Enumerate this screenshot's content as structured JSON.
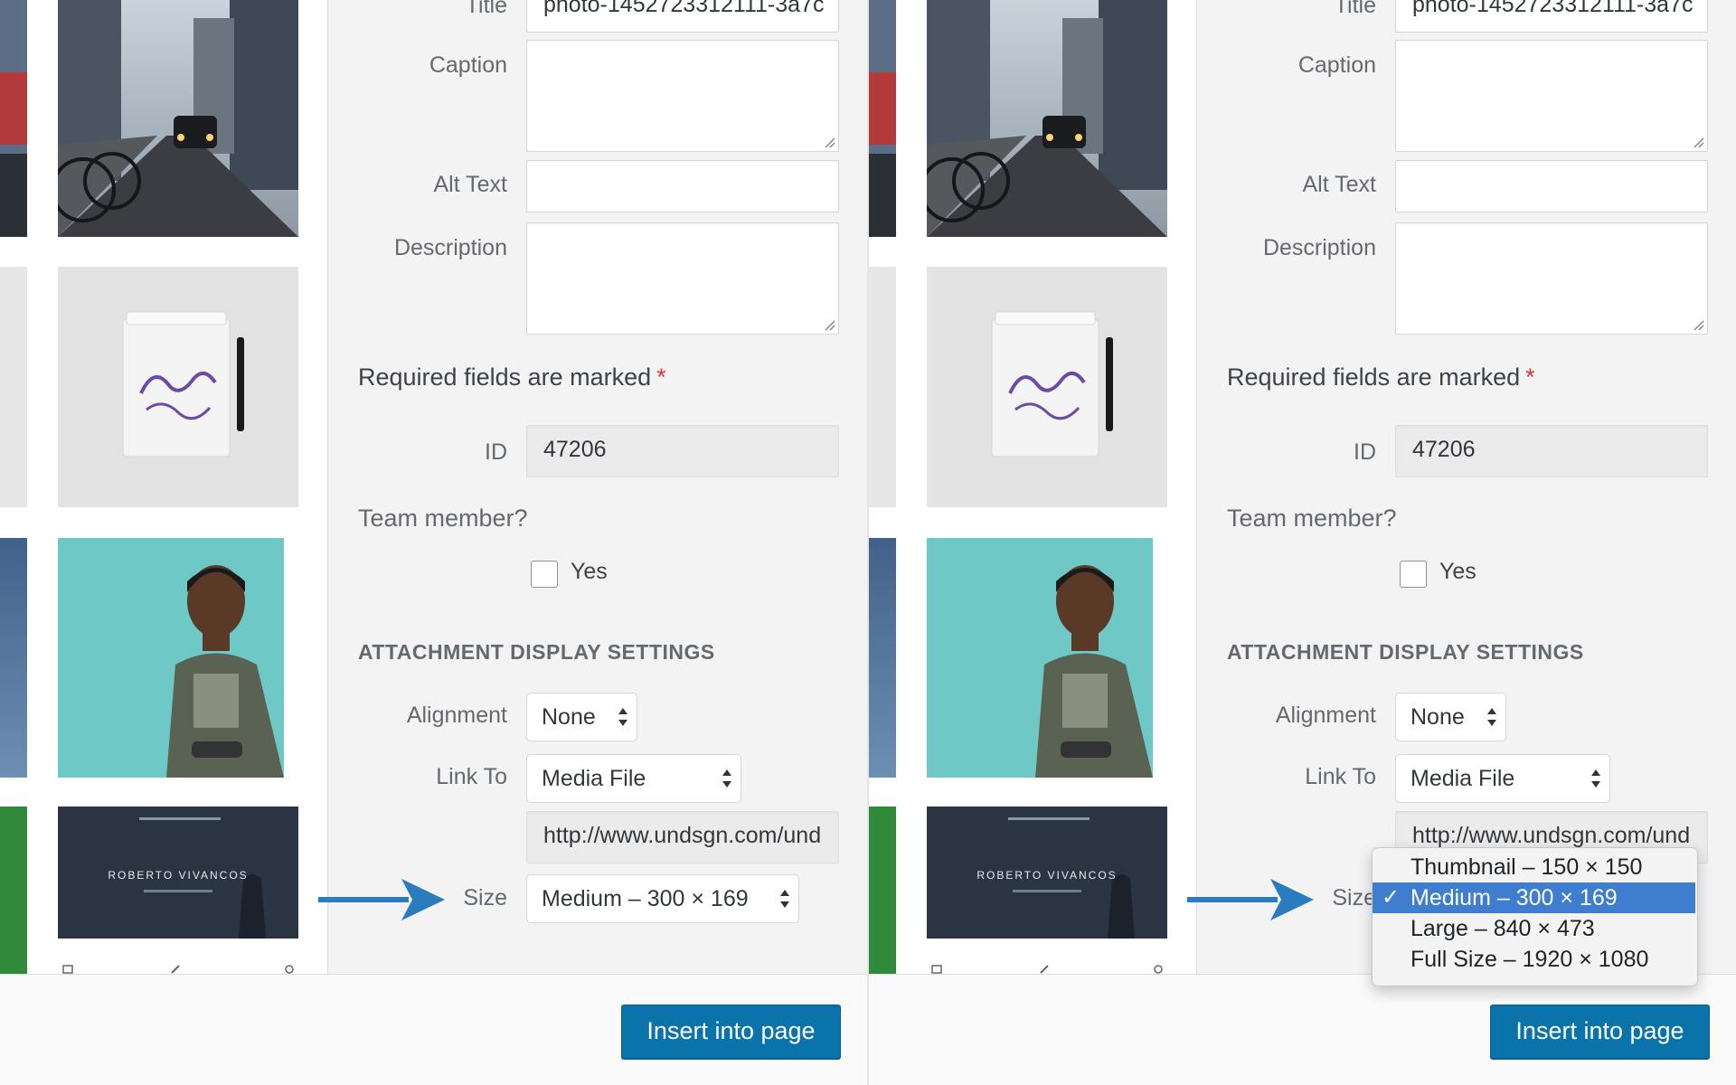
{
  "sidebar": {
    "title_label": "Title",
    "title_value": "photo-1452723312111-3a7c",
    "caption_label": "Caption",
    "alt_label": "Alt Text",
    "description_label": "Description",
    "required_text": "Required fields are marked",
    "required_star": "*",
    "id_label": "ID",
    "id_value": "47206",
    "team_label": "Team member?",
    "team_checkbox_label": "Yes",
    "section_heading": "ATTACHMENT DISPLAY SETTINGS",
    "alignment_label": "Alignment",
    "alignment_value": "None",
    "link_label": "Link To",
    "link_value": "Media File",
    "url_value": "http://www.undsgn.com/und",
    "size_label": "Size",
    "size_value": "Medium – 300 × 169"
  },
  "size_options": [
    "Thumbnail – 150 × 150",
    "Medium – 300 × 169",
    "Large – 840 × 473",
    "Full Size – 1920 × 1080"
  ],
  "size_selected_index": 1,
  "thumb_banner_text": "ROBERTO VIVANCOS",
  "footer": {
    "insert_label": "Insert into page"
  },
  "colors": {
    "accent": "#0a73aa",
    "arrow": "#2b7bbf",
    "selected_option": "#3f7dcf",
    "required_star": "#d63638"
  }
}
